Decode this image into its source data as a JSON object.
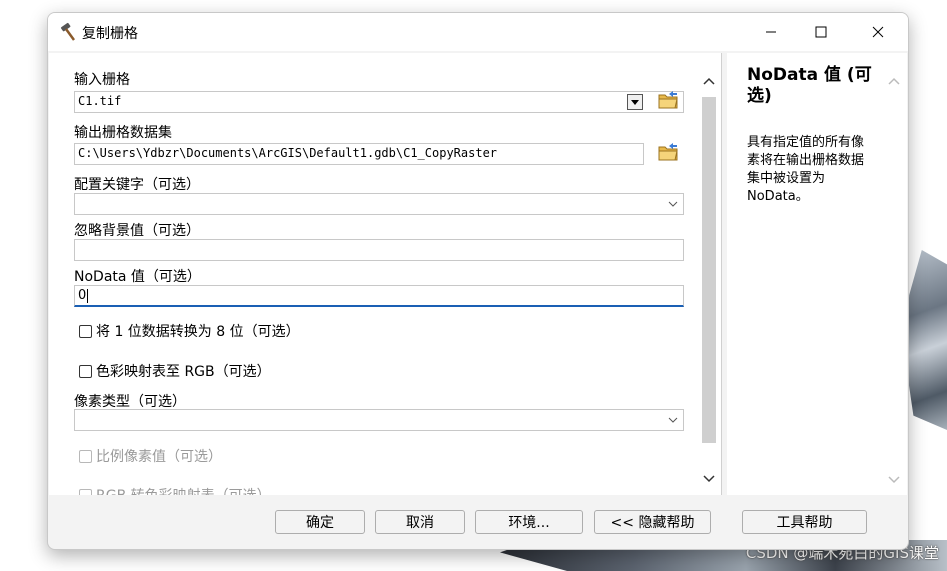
{
  "window": {
    "title": "复制栅格",
    "icon": "hammer-icon",
    "controls": {
      "minimize": "minimize-icon",
      "maximize": "maximize-icon",
      "close": "close-icon"
    }
  },
  "form": {
    "input_raster": {
      "label": "输入栅格",
      "value": "C1.tif"
    },
    "output_dataset": {
      "label": "输出栅格数据集",
      "value": "C:\\Users\\Ydbzr\\Documents\\ArcGIS\\Default1.gdb\\C1_CopyRaster"
    },
    "config_keyword": {
      "label": "配置关键字（可选）",
      "value": ""
    },
    "ignore_background": {
      "label": "忽略背景值（可选）",
      "value": ""
    },
    "nodata": {
      "label": "NoData 值（可选）",
      "value": "0"
    },
    "convert_1bit": {
      "label": "将 1 位数据转换为 8 位（可选）",
      "checked": false
    },
    "colormap_rgb": {
      "label": "色彩映射表至 RGB（可选）",
      "checked": false
    },
    "pixel_type": {
      "label": "像素类型（可选）",
      "value": ""
    },
    "scale_pixel": {
      "label": "比例像素值（可选）",
      "checked": false,
      "enabled": false
    },
    "rgb_to_colormap": {
      "label": "RGB 转色彩映射表（可选）",
      "checked": false,
      "enabled": false
    }
  },
  "help": {
    "title": "NoData 值 (可选)",
    "text": "具有指定值的所有像素将在输出栅格数据集中被设置为 NoData。"
  },
  "buttons": {
    "ok": "确定",
    "cancel": "取消",
    "env": "环境...",
    "hide_help": "<< 隐藏帮助",
    "tool_help": "工具帮助"
  },
  "watermark": "CSDN @端木宛白的GIS课堂",
  "colors": {
    "accent": "#1a5fb4",
    "folder": "#e8b94a"
  }
}
